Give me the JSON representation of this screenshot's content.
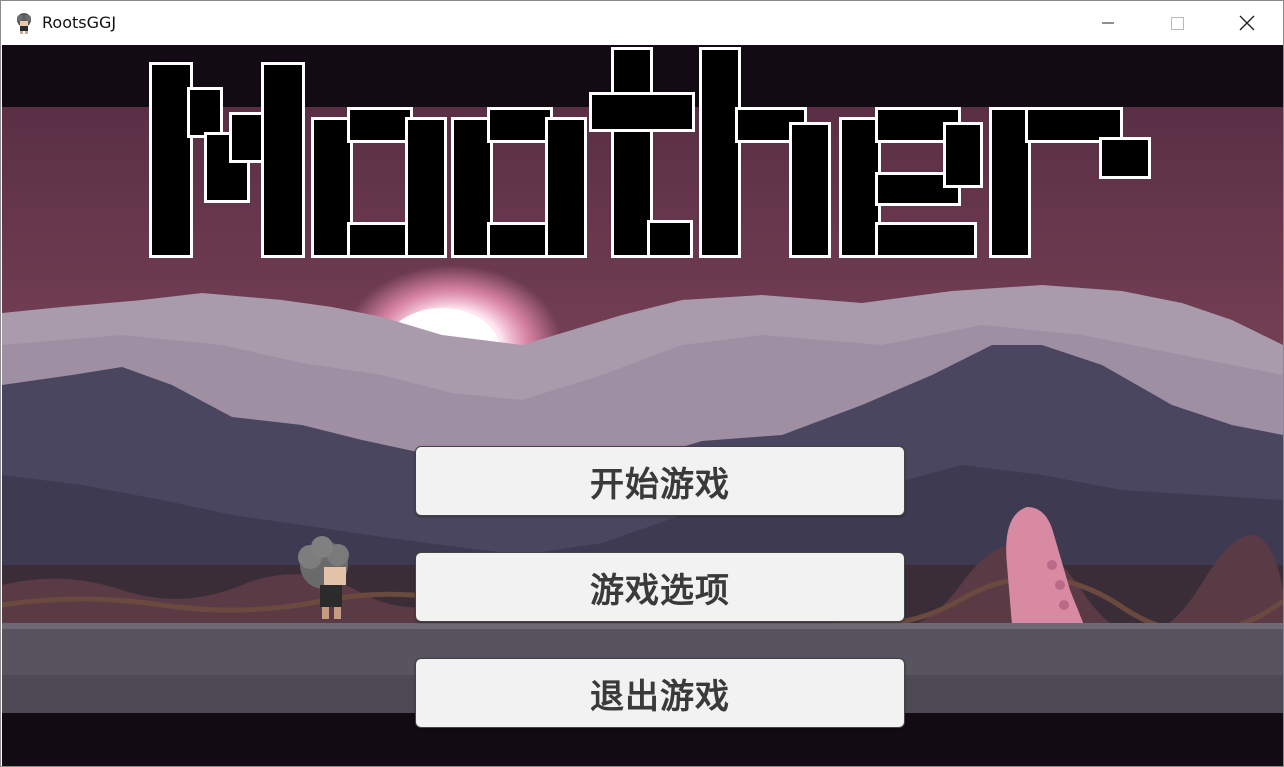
{
  "window": {
    "title": "RootsGGJ",
    "controls": [
      "minimize-icon",
      "maximize-icon",
      "close-icon"
    ]
  },
  "game": {
    "logo_text": "Moother",
    "menu": [
      {
        "label": "开始游戏"
      },
      {
        "label": "游戏选项"
      },
      {
        "label": "退出游戏"
      }
    ]
  },
  "colors": {
    "sky": "#7a4358",
    "sky_dark": "#5a2f45",
    "mist": "#a99aac",
    "mountain": "#4b4660",
    "ground": "#57535f",
    "tentacle": "#d98aa3",
    "sun_glow": "#ff9ec0"
  }
}
